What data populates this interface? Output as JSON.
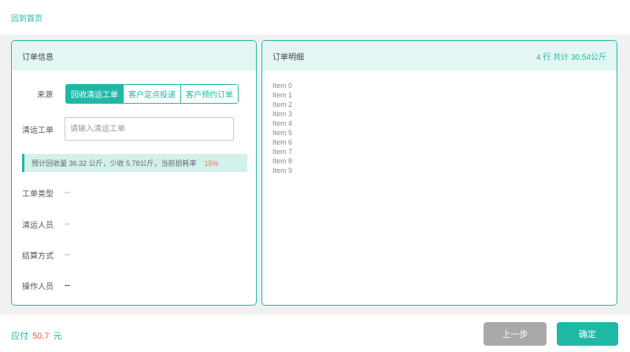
{
  "header": {
    "home_link": "回到首页"
  },
  "order_info": {
    "title": "订单信息",
    "source_label": "来源",
    "source_options": [
      "回收清运工单",
      "客户定点投递",
      "客户预约订单"
    ],
    "source_selected": "回收清运工单",
    "work_order_label": "清运工单",
    "work_order_placeholder": "请输入清运工单",
    "work_order_value": "",
    "notice_text": "预计回收量 36.32 公斤，少收 5.78公斤，当前损耗率",
    "notice_rate": "15%",
    "fields": [
      {
        "label": "工单类型",
        "value": "--"
      },
      {
        "label": "清运人员",
        "value": "--"
      },
      {
        "label": "结算方式",
        "value": "--"
      },
      {
        "label": "操作人员",
        "value": "--"
      }
    ]
  },
  "order_detail": {
    "title": "订单明细",
    "summary": "4 行 共计 30.54公斤",
    "items": [
      "Item 0",
      "Item 1",
      "Item 2",
      "Item 3",
      "Item 4",
      "Item 5",
      "Item 6",
      "Item 7",
      "Item 8",
      "Item 9"
    ]
  },
  "footer": {
    "pay_label": "应付",
    "pay_amount": "50.7",
    "pay_unit": "元",
    "prev_button": "上一步",
    "confirm_button": "确定"
  },
  "colors": {
    "accent": "#1fb8a5",
    "accent_light": "#e3f6f4",
    "warning": "#f07a3c",
    "amount": "#f0564a",
    "disabled": "#a9a9a9"
  }
}
